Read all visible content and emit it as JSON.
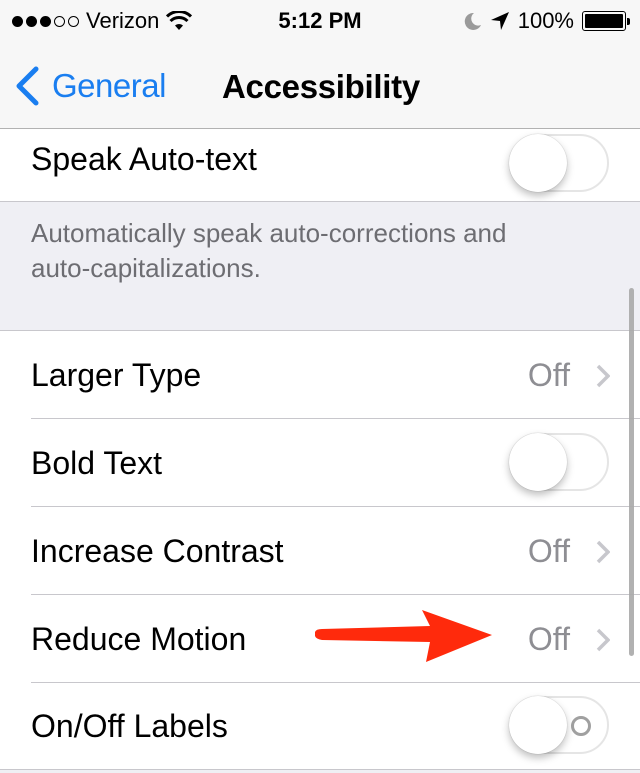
{
  "status_bar": {
    "signal_bars_filled": 3,
    "signal_bars_total": 5,
    "carrier": "Verizon",
    "wifi_icon": "wifi-icon",
    "time": "5:12 PM",
    "do_not_disturb_icon": "moon-icon",
    "location_icon": "location-arrow-icon",
    "battery_percent_label": "100%",
    "battery_level": 1.0
  },
  "nav": {
    "back_label": "General",
    "back_icon": "chevron-left-icon",
    "title": "Accessibility"
  },
  "colors": {
    "accent": "#1a7ef0",
    "annotation_arrow": "#ff2a0c",
    "group_background": "#efeff4",
    "secondary_text": "#8e8e93"
  },
  "rows": [
    {
      "label": "Speak Auto-text",
      "type": "toggle",
      "on": false
    },
    {
      "label": "Larger Type",
      "type": "disclosure",
      "value": "Off"
    },
    {
      "label": "Bold Text",
      "type": "toggle",
      "on": false
    },
    {
      "label": "Increase Contrast",
      "type": "disclosure",
      "value": "Off"
    },
    {
      "label": "Reduce Motion",
      "type": "disclosure",
      "value": "Off"
    },
    {
      "label": "On/Off Labels",
      "type": "toggle",
      "on": false
    }
  ],
  "footer": {
    "speak_auto_text_description": "Automatically speak auto-corrections and auto-capitalizations."
  },
  "annotation": {
    "type": "arrow",
    "points_to": "Reduce Motion value"
  }
}
